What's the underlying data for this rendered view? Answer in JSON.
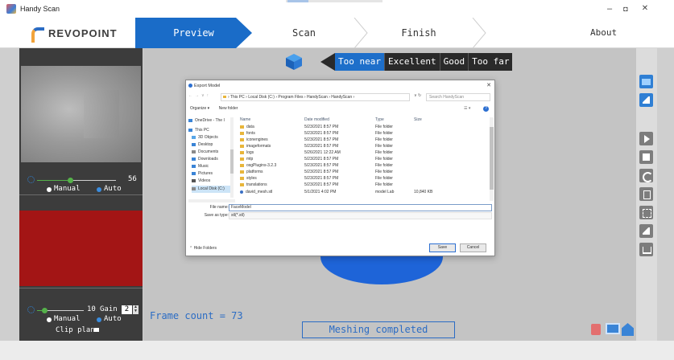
{
  "window": {
    "title": "Handy Scan",
    "minimize": "–",
    "maximize": "◘",
    "close": "✕"
  },
  "brand": {
    "name": "REVOPOINT"
  },
  "steps": [
    {
      "label": "Preview"
    },
    {
      "label": "Scan"
    },
    {
      "label": "Finish"
    }
  ],
  "about_label": "About",
  "camera_top": {
    "value": "56",
    "mode_manual": "Manual",
    "mode_auto": "Auto"
  },
  "camera_bottom": {
    "value": "10",
    "gain_label": "Gain",
    "gain_value": "2",
    "mode_manual": "Manual",
    "mode_auto": "Auto",
    "clip_plane": "Clip plane"
  },
  "distance": {
    "items": [
      "Too near",
      "Excellent",
      "Good",
      "Too far"
    ],
    "active_index": 0
  },
  "frame_count": "Frame count = 73",
  "status": "Meshing completed",
  "dialog": {
    "title": "Export Model",
    "breadcrumb": "›  This PC  ›  Local Disk (C:)  ›  Program Files  ›  HandyScan  ›  HandyScan  ›",
    "search_placeholder": "Search HandyScan",
    "organize": "Organize ▾",
    "new_folder": "New folder",
    "nav_items": [
      {
        "label": "OneDrive - The I",
        "color": "#3a84d6"
      },
      {
        "label": "This PC",
        "color": "#3a84d6"
      },
      {
        "label": "3D Objects",
        "color": "#58a6e8"
      },
      {
        "label": "Desktop",
        "color": "#3a84d6"
      },
      {
        "label": "Documents",
        "color": "#8a8a8a"
      },
      {
        "label": "Downloads",
        "color": "#3a84d6"
      },
      {
        "label": "Music",
        "color": "#3a84d6"
      },
      {
        "label": "Pictures",
        "color": "#3a84d6"
      },
      {
        "label": "Videos",
        "color": "#555555"
      },
      {
        "label": "Local Disk (C:)",
        "color": "#8a8a8a"
      }
    ],
    "columns": [
      "Name",
      "Date modified",
      "Type",
      "Size"
    ],
    "files": [
      {
        "name": "data",
        "date": "5/23/2021 8:57 PM",
        "type": "File folder",
        "size": ""
      },
      {
        "name": "fonts",
        "date": "5/23/2021 8:57 PM",
        "type": "File folder",
        "size": ""
      },
      {
        "name": "iconengines",
        "date": "5/23/2021 8:57 PM",
        "type": "File folder",
        "size": ""
      },
      {
        "name": "imageformats",
        "date": "5/23/2021 8:57 PM",
        "type": "File folder",
        "size": ""
      },
      {
        "name": "logs",
        "date": "5/26/2021 12:22 AM",
        "type": "File folder",
        "size": ""
      },
      {
        "name": "mtp",
        "date": "5/23/2021 8:57 PM",
        "type": "File folder",
        "size": ""
      },
      {
        "name": "osgPlugins-3.2.3",
        "date": "5/23/2021 8:57 PM",
        "type": "File folder",
        "size": ""
      },
      {
        "name": "platforms",
        "date": "5/23/2021 8:57 PM",
        "type": "File folder",
        "size": ""
      },
      {
        "name": "styles",
        "date": "5/23/2021 8:57 PM",
        "type": "File folder",
        "size": ""
      },
      {
        "name": "translations",
        "date": "5/23/2021 8:57 PM",
        "type": "File folder",
        "size": ""
      },
      {
        "name": "david_mesh.stl",
        "date": "5/1/2021 4:02 PM",
        "type": "model Lab",
        "size": "10,840 KB"
      }
    ],
    "file_name_label": "File name:",
    "file_name_value": "FaceModel",
    "save_type_label": "Save as type:",
    "save_type_value": "stl(*.stl)",
    "hide_folders": "Hide Folders",
    "save_button": "Save",
    "cancel_button": "Cancel",
    "close": "✕"
  },
  "colors": {
    "accent": "#1a6cc8",
    "status_text": "#2b6cc4",
    "camera_red": "#a31515"
  }
}
